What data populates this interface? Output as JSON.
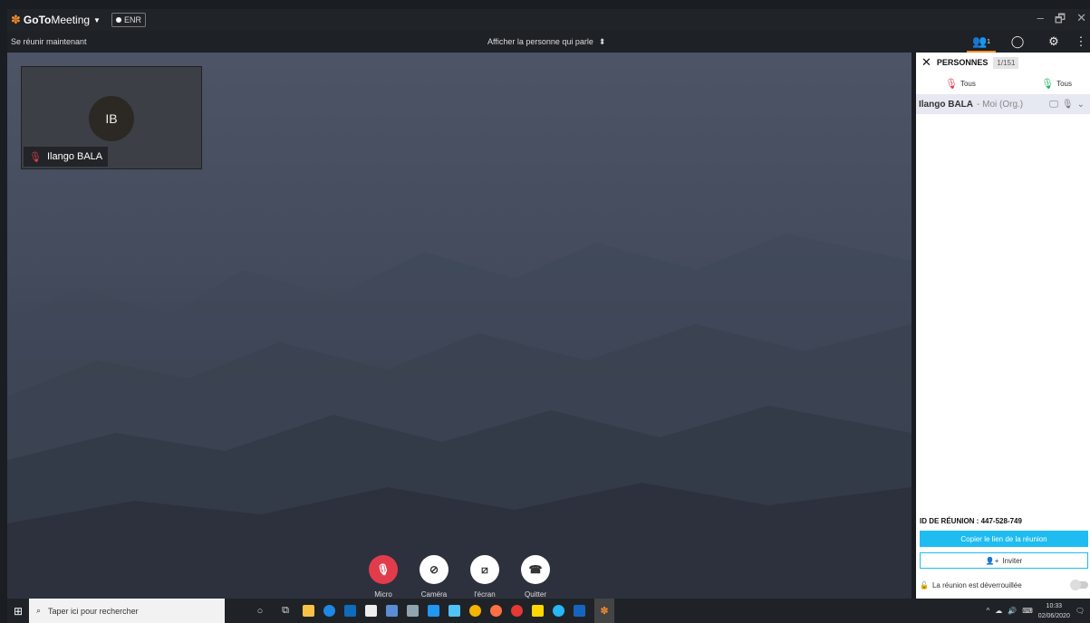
{
  "titlebar": {
    "app_name_bold": "GoTo",
    "app_name_rest": "Meeting",
    "record_label": "ENR",
    "window_controls": [
      "–",
      "🗗",
      "✕"
    ]
  },
  "toolbar": {
    "left_text": "Se réunir maintenant",
    "center_text": "Afficher la personne qui parle",
    "participant_count": "1"
  },
  "tile": {
    "initials": "IB",
    "name": "Ilango BALA"
  },
  "controls": [
    {
      "label": "Micro",
      "icon": "mic-off-icon"
    },
    {
      "label": "Caméra",
      "icon": "camera-off-icon"
    },
    {
      "label": "l'écran",
      "icon": "screen-share-icon"
    },
    {
      "label": "Quitter",
      "icon": "hangup-icon"
    }
  ],
  "panel": {
    "title": "PERSONNES",
    "count": "1/151",
    "mute_all_label": "Tous",
    "unmute_all_label": "Tous",
    "participant_name": "Ilango BALA",
    "participant_role": "- Moi (Org.)",
    "meeting_id_label": "ID DE RÉUNION :",
    "meeting_id": "447-528-749",
    "copy_link_label": "Copier le lien de la réunion",
    "invite_label": "Inviter",
    "lock_status": "La réunion est déverrouillée"
  },
  "taskbar": {
    "search_placeholder": "Taper ici pour rechercher",
    "time": "10:33",
    "date": "02/06/2020"
  },
  "colors": {
    "brand_orange": "#f68d2e",
    "mute_red": "#e23c4c",
    "copy_blue": "#1ebcf1",
    "unmute_green": "#1db35b"
  }
}
